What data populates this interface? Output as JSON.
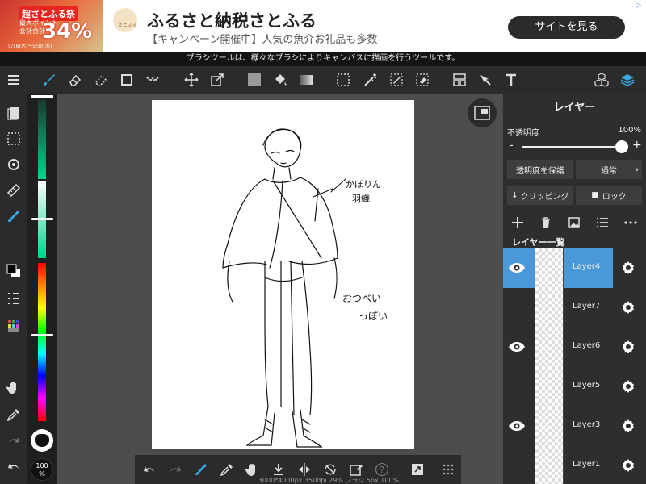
{
  "ad": {
    "tag": "超さとふる祭",
    "percent": "34%",
    "sub_line": "最大ポイント",
    "sub_line2": "会計合計",
    "foot": "5/16(木)〜5/30(木)",
    "logo_text": "さとふる",
    "title": "ふるさと納税さとふる",
    "description": "【キャンペーン開催中】人気の魚介お礼品も多数",
    "button": "サイトを見る"
  },
  "hint": "ブラシツールは、様々なブラシによりキャンバスに描画を行うツールです。",
  "toolbar": {
    "icons": [
      "menu-icon",
      "brush-icon",
      "eraser-icon",
      "blur-icon",
      "rectangle-icon",
      "dot-icon",
      "move-icon",
      "transform-icon",
      "fill-color-icon",
      "bucket-icon",
      "gradient-icon",
      "select-icon",
      "magic-wand-icon",
      "select-pen-icon",
      "select-eraser-icon",
      "frame-icon",
      "operation-icon",
      "text-icon",
      "3d-material-icon",
      "layers-icon"
    ],
    "active": "brush-icon"
  },
  "colors": {
    "accent": "#3aa8e0",
    "selected_layer": "#4a98d8",
    "foreground": "#000000",
    "background": "#ffffff"
  },
  "canvas": {
    "status": "3000*4000px 350dpi 29% ブラシ 5px 100%"
  },
  "zoom_badge": "100\n%",
  "panel": {
    "title": "レイヤー",
    "opacity_label": "不透明度",
    "opacity_value": "100%",
    "opacity": 1.0,
    "protect_alpha": "透明度を保護",
    "blend_mode": "通常",
    "clipping": "クリッピング",
    "lock": "ロック",
    "list_title": "レイヤー一覧",
    "layers": [
      {
        "name": "Layer4",
        "visible": true,
        "selected": true
      },
      {
        "name": "Layer7",
        "visible": false,
        "selected": false
      },
      {
        "name": "Layer6",
        "visible": true,
        "selected": false
      },
      {
        "name": "Layer5",
        "visible": false,
        "selected": false
      },
      {
        "name": "Layer3",
        "visible": true,
        "selected": false
      },
      {
        "name": "Layer1",
        "visible": false,
        "selected": false
      }
    ]
  },
  "sketch_notes": {
    "note1_line1": "かぼりん",
    "note1_line2": "羽織",
    "note2_line1": "おつべい",
    "note2_line2": "っぽい"
  }
}
